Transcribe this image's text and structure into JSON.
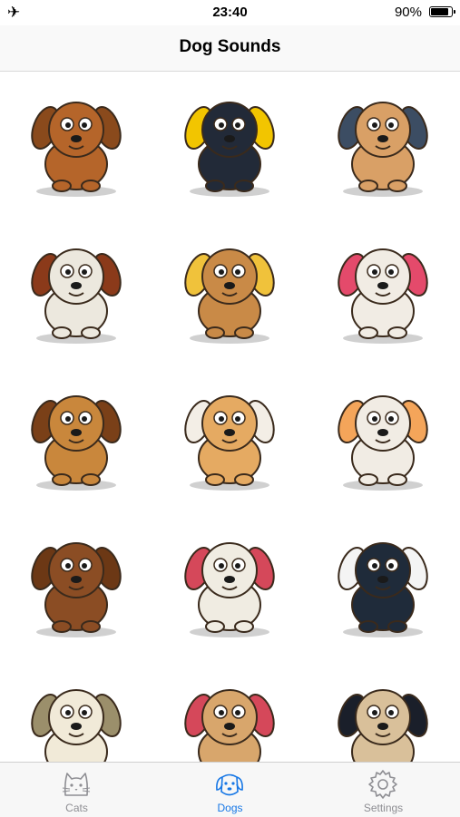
{
  "status_bar": {
    "time": "23:40",
    "battery_percent": "90%",
    "battery_level": 0.9,
    "airplane_icon": "airplane-icon"
  },
  "nav": {
    "title": "Dog Sounds"
  },
  "grid": {
    "items": [
      {
        "name": "brown-dog-with-bone",
        "body": "#b5652a",
        "accent": "#8a4a1c"
      },
      {
        "name": "black-dog-with-ball",
        "body": "#222a38",
        "accent": "#f2c500"
      },
      {
        "name": "chihuahua-with-dumbbell",
        "body": "#d9a066",
        "accent": "#3c4d63"
      },
      {
        "name": "white-shaggy-dog-barking",
        "body": "#ece8de",
        "accent": "#8b3a1a"
      },
      {
        "name": "basset-hound-party-hat",
        "body": "#c98a47",
        "accent": "#f0c23b"
      },
      {
        "name": "cavalier-with-pink-bows",
        "body": "#f1ece4",
        "accent": "#e44a6b"
      },
      {
        "name": "bulldog-with-boxing-gloves",
        "body": "#c9873c",
        "accent": "#7a4018"
      },
      {
        "name": "chihuahua-with-big-bone",
        "body": "#e5aa62",
        "accent": "#f3eee6"
      },
      {
        "name": "chihuahua-in-martini-glass",
        "body": "#f1ece4",
        "accent": "#f4a55a"
      },
      {
        "name": "dachshund-with-poop",
        "body": "#8b4d24",
        "accent": "#6c3815"
      },
      {
        "name": "maltese-tongue-out",
        "body": "#f0ece2",
        "accent": "#d5485a"
      },
      {
        "name": "husky-in-fedora",
        "body": "#1f2b3a",
        "accent": "#f4f4f4"
      },
      {
        "name": "golden-puppy",
        "body": "#f1ead8",
        "accent": "#9b8f6b"
      },
      {
        "name": "pug-tongue-out",
        "body": "#d8a66c",
        "accent": "#d5485a"
      },
      {
        "name": "bulldog-top-hat",
        "body": "#d9c09a",
        "accent": "#1a1f2a"
      }
    ]
  },
  "tabs": [
    {
      "label": "Cats",
      "icon": "cat-icon",
      "active": false
    },
    {
      "label": "Dogs",
      "icon": "dog-icon",
      "active": true
    },
    {
      "label": "Settings",
      "icon": "gear-icon",
      "active": false
    }
  ],
  "colors": {
    "active_tab": "#1677e6",
    "inactive_tab": "#8e8e93",
    "shadow": "#bcbcbc"
  }
}
